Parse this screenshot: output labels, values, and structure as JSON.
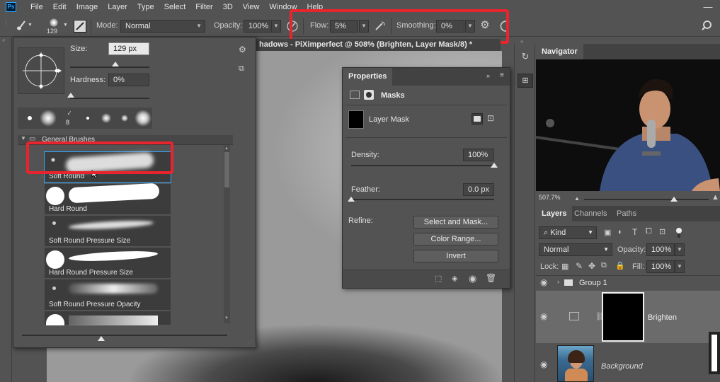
{
  "menubar": {
    "logo": "Ps",
    "items": [
      "File",
      "Edit",
      "Image",
      "Layer",
      "Type",
      "Select",
      "Filter",
      "3D",
      "View",
      "Window",
      "Help"
    ]
  },
  "options": {
    "brush_size": "129",
    "mode_label": "Mode:",
    "mode_value": "Normal",
    "opacity_label": "Opacity:",
    "opacity_value": "100%",
    "flow_label": "Flow:",
    "flow_value": "5%",
    "smoothing_label": "Smoothing:",
    "smoothing_value": "0%"
  },
  "document": {
    "tab_title": "hadows - PiXimperfect @ 508% (Brighten, Layer Mask/8) *"
  },
  "brush_panel": {
    "size_label": "Size:",
    "size_value": "129 px",
    "hardness_label": "Hardness:",
    "hardness_value": "0%",
    "recent_count": "8",
    "group_name": "General Brushes",
    "brushes": [
      {
        "name": "Soft Round"
      },
      {
        "name": "Hard Round"
      },
      {
        "name": "Soft Round Pressure Size"
      },
      {
        "name": "Hard Round Pressure Size"
      },
      {
        "name": "Soft Round Pressure Opacity"
      },
      {
        "name": ""
      }
    ]
  },
  "properties": {
    "title": "Properties",
    "masks_label": "Masks",
    "layer_mask_label": "Layer Mask",
    "density_label": "Density:",
    "density_value": "100%",
    "density_fraction": 1.0,
    "feather_label": "Feather:",
    "feather_value": "0.0 px",
    "feather_fraction": 0.0,
    "refine_label": "Refine:",
    "select_mask_button": "Select and Mask...",
    "color_range_button": "Color Range...",
    "invert_button": "Invert"
  },
  "navigator": {
    "title": "Navigator",
    "zoom": "507.7%",
    "zoom_fraction": 0.72
  },
  "layers_panel": {
    "tabs": [
      "Layers",
      "Channels",
      "Paths"
    ],
    "filter_kind": "Kind",
    "blend_mode": "Normal",
    "opacity_label": "Opacity:",
    "opacity_value": "100%",
    "lock_label": "Lock:",
    "fill_label": "Fill:",
    "fill_value": "100%",
    "layers": [
      {
        "name": "Group 1"
      },
      {
        "name": "Brighten"
      },
      {
        "name": "Background"
      }
    ]
  },
  "colors": {
    "highlight": "#e8252f",
    "panel_bg": "#535353",
    "panel_dark": "#424242",
    "selection": "#31a8ff"
  }
}
